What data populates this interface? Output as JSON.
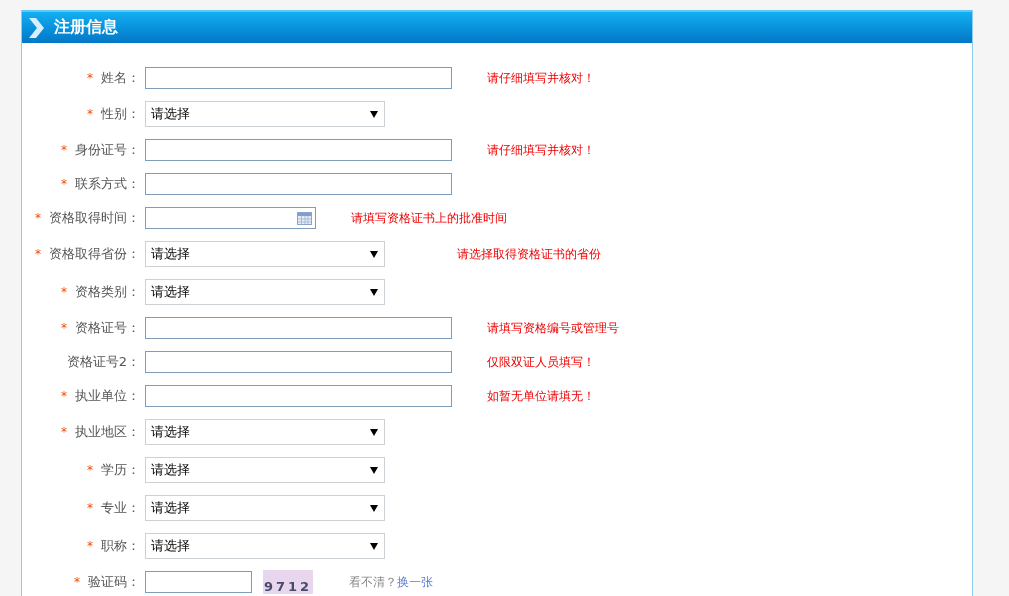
{
  "panel": {
    "title": "注册信息"
  },
  "fields": [
    {
      "kind": "text",
      "mark": "*",
      "label": "姓名：",
      "hint": "请仔细填写并核对！"
    },
    {
      "kind": "select",
      "mark": "*",
      "label": "性别：",
      "value": "请选择"
    },
    {
      "kind": "text",
      "mark": "*",
      "label": "身份证号：",
      "hint": "请仔细填写并核对！"
    },
    {
      "kind": "text",
      "mark": "*",
      "label": "联系方式："
    },
    {
      "kind": "date",
      "mark": "*",
      "label": "资格取得时间：",
      "hint": "请填写资格证书上的批准时间"
    },
    {
      "kind": "select",
      "mark": "*",
      "label": "资格取得省份：",
      "value": "请选择",
      "hint": "请选择取得资格证书的省份"
    },
    {
      "kind": "select",
      "mark": "*",
      "label": "资格类别：",
      "value": "请选择"
    },
    {
      "kind": "text",
      "mark": "*",
      "label": "资格证号：",
      "hint": "请填写资格编号或管理号"
    },
    {
      "kind": "text",
      "label": "资格证号2：",
      "hint": "仅限双证人员填写！"
    },
    {
      "kind": "text",
      "mark": "*",
      "label": "执业单位：",
      "hint": "如暂无单位请填无！"
    },
    {
      "kind": "select",
      "mark": "*",
      "label": "执业地区：",
      "value": "请选择"
    },
    {
      "kind": "select",
      "mark": "*",
      "label": "学历：",
      "value": "请选择"
    },
    {
      "kind": "select",
      "mark": "*",
      "label": "专业：",
      "value": "请选择"
    },
    {
      "kind": "select",
      "mark": "*",
      "label": "职称：",
      "value": "请选择"
    },
    {
      "kind": "captcha",
      "mark": "*",
      "label": "验证码：",
      "code": "9712",
      "prompt": "看不清？",
      "link": "换一张"
    }
  ]
}
